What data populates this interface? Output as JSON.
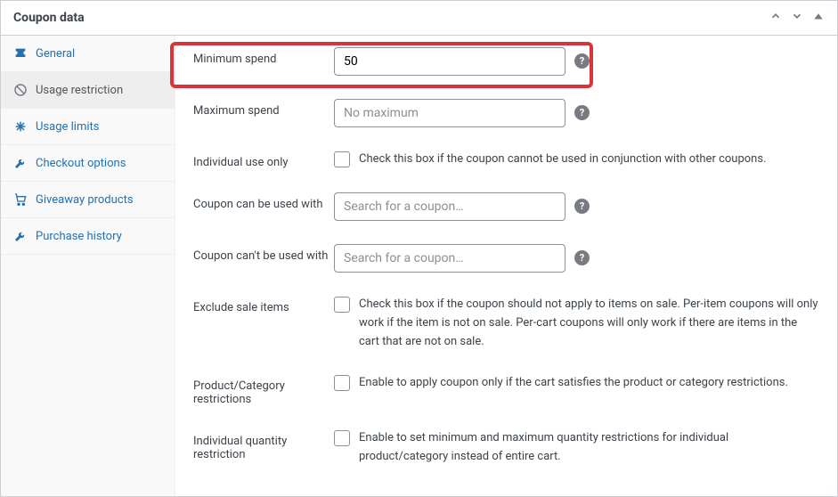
{
  "panel": {
    "title": "Coupon data"
  },
  "sidebar": {
    "items": [
      {
        "label": "General",
        "icon": "ticket"
      },
      {
        "label": "Usage restriction",
        "icon": "block",
        "active": true
      },
      {
        "label": "Usage limits",
        "icon": "limits"
      },
      {
        "label": "Checkout options",
        "icon": "wrench"
      },
      {
        "label": "Giveaway products",
        "icon": "cart"
      },
      {
        "label": "Purchase history",
        "icon": "wrench"
      }
    ]
  },
  "form": {
    "min_spend": {
      "label": "Minimum spend",
      "value": "50"
    },
    "max_spend": {
      "label": "Maximum spend",
      "placeholder": "No maximum"
    },
    "individual_use": {
      "label": "Individual use only",
      "desc": "Check this box if the coupon cannot be used in conjunction with other coupons."
    },
    "can_be_used_with": {
      "label": "Coupon can be used with",
      "placeholder": "Search for a coupon…"
    },
    "cant_be_used_with": {
      "label": "Coupon can't be used with",
      "placeholder": "Search for a coupon…"
    },
    "exclude_sale": {
      "label": "Exclude sale items",
      "desc": "Check this box if the coupon should not apply to items on sale. Per-item coupons will only work if the item is not on sale. Per-cart coupons will only work if there are items in the cart that are not on sale."
    },
    "prod_cat_restrict": {
      "label": "Product/Category restrictions",
      "desc": "Enable to apply coupon only if the cart satisfies the product or category restrictions."
    },
    "indiv_qty_restrict": {
      "label": "Individual quantity restriction",
      "desc": "Enable to set minimum and maximum quantity restrictions for individual product/category instead of entire cart."
    }
  }
}
